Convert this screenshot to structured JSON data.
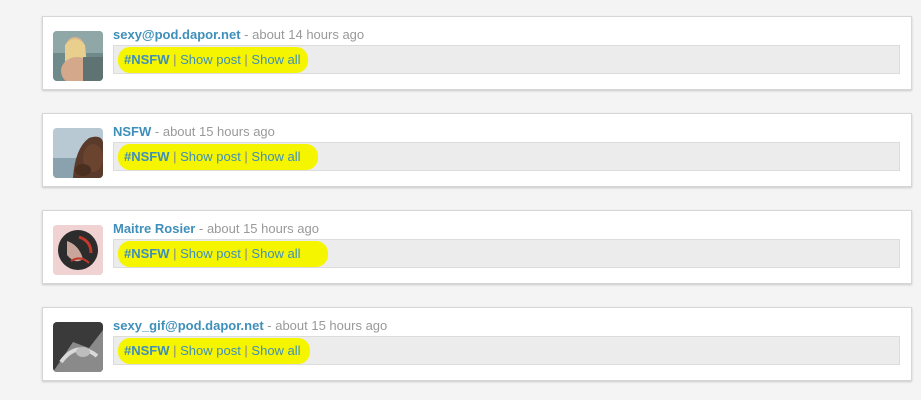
{
  "posts": [
    {
      "author": "sexy@pod.dapor.net",
      "separator": " - ",
      "time": "about 14 hours ago",
      "tag": "#NSFW",
      "divider": " | ",
      "show_post": "Show post",
      "show_all": "Show all"
    },
    {
      "author": "NSFW",
      "separator": " - ",
      "time": "about 15 hours ago",
      "tag": "#NSFW",
      "divider": " | ",
      "show_post": "Show post",
      "show_all": "Show all"
    },
    {
      "author": "Maitre Rosier",
      "separator": " - ",
      "time": "about 15 hours ago",
      "tag": "#NSFW",
      "divider": " | ",
      "show_post": "Show post",
      "show_all": "Show all"
    },
    {
      "author": "sexy_gif@pod.dapor.net",
      "separator": " - ",
      "time": "about 15 hours ago",
      "tag": "#NSFW",
      "divider": " | ",
      "show_post": "Show post",
      "show_all": "Show all"
    }
  ],
  "colors": {
    "link": "#3f8fba",
    "muted": "#999999",
    "highlight": "#f5f500"
  }
}
